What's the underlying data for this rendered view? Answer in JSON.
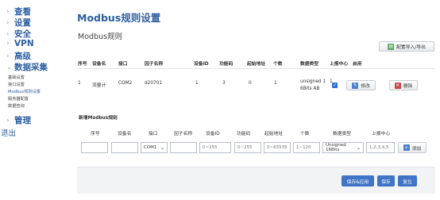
{
  "sidebar": {
    "items": [
      {
        "label": "查看"
      },
      {
        "label": "设置"
      },
      {
        "label": "安全"
      },
      {
        "label": "VPN"
      },
      {
        "label": "高级"
      },
      {
        "label": "数据采集"
      },
      {
        "label": "管理"
      }
    ],
    "subitems": [
      {
        "label": "基础设置"
      },
      {
        "label": "接口设置"
      },
      {
        "label": "Modbus规则设置"
      },
      {
        "label": "服务器配置"
      },
      {
        "label": "数据查询"
      }
    ],
    "logout": "退出"
  },
  "page": {
    "title": "Modbus规则设置",
    "section_title": "Modbus规则",
    "import_export": "配置导入/导出"
  },
  "table": {
    "headers": [
      "序号",
      "设备名",
      "接口",
      "因子名称",
      "设备ID",
      "功能码",
      "起始地址",
      "个数",
      "数据类型",
      "上报中心",
      "启用"
    ],
    "rows": [
      {
        "index": "1",
        "device": "流量计",
        "iface": "COM2",
        "factor": "d20701",
        "device_id": "1",
        "func_code": "3",
        "start_addr": "0",
        "count": "1",
        "data_type_1": "unsigned 1",
        "data_type_2": "6Bits AB",
        "report": "1",
        "enabled": "✓"
      }
    ],
    "edit": "修改",
    "delete": "删除"
  },
  "new_rule": {
    "title": "新增Modbus规则",
    "headers": [
      "序号",
      "设备名",
      "接口",
      "因子名称",
      "设备ID",
      "功能码",
      "起始地址",
      "个数",
      "数据类型",
      "上报中心"
    ],
    "iface_value": "COM1",
    "device_id_placeholder": "0~255",
    "func_code_placeholder": "0~255",
    "start_addr_placeholder": "0~65535",
    "count_placeholder": "1~120",
    "data_type_value": "Unsigned 16Bits",
    "report_placeholder": "1,2,3,4,5",
    "add": "添加"
  },
  "footer": {
    "save_apply": "保存&应用",
    "save": "保存",
    "reset": "复位"
  },
  "colors": {
    "accent": "#2d5fa0",
    "primary_button": "#3f74c6"
  }
}
